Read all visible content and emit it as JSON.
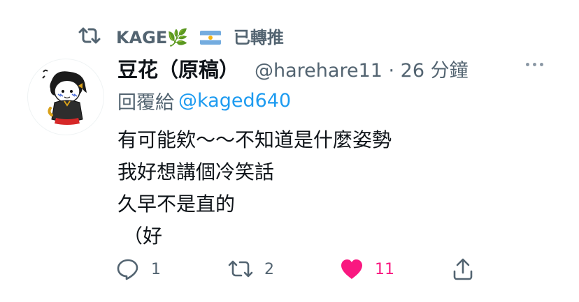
{
  "retweet": {
    "label": "KAGE🌿",
    "suffix": "已轉推",
    "flag": "argentina-flag"
  },
  "tweet": {
    "display_name": "豆花（原稿）",
    "handle_time": "@harehare11 · 26 分鐘",
    "reply_label": "回覆給",
    "reply_handle": "@kaged640",
    "lines": [
      "有可能欸～～不知道是什麼姿勢",
      "我好想講個冷笑話",
      "久早不是直的",
      "（好"
    ]
  },
  "actions": {
    "reply_count": "1",
    "retweet_count": "2",
    "like_count": "11"
  },
  "colors": {
    "secondary": "#536471",
    "link": "#1d9bf0",
    "like": "#f91880",
    "text": "#0f1419"
  },
  "icons": [
    "retweet-icon",
    "more-icon",
    "reply-icon",
    "like-icon",
    "share-icon"
  ]
}
